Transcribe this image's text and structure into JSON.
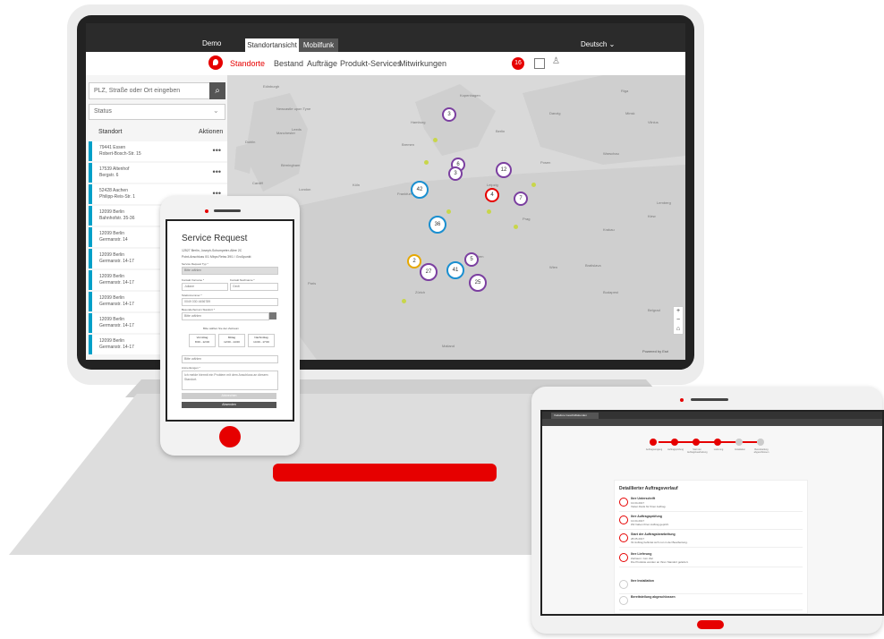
{
  "laptop_app": {
    "brand": "Demo",
    "tabs": [
      "Standortansicht",
      "Mobilfunk"
    ],
    "language": "Deutsch",
    "nav": [
      "Standorte",
      "Bestand",
      "Aufträge",
      "Produkt-Services",
      "Mitwirkungen"
    ],
    "notification_count": "16",
    "search_placeholder": "PLZ, Straße oder Ort eingeben",
    "status_label": "Status",
    "table_headers": [
      "Standort",
      "Aktionen"
    ],
    "rows": [
      {
        "line1": "79441 Essen",
        "line2": "Robert-Bosch-Str. 15"
      },
      {
        "line1": "17539 Altenhof",
        "line2": "Bergstr. 6"
      },
      {
        "line1": "52428 Aachen",
        "line2": "Philipp-Reis-Str. 1"
      },
      {
        "line1": "12099 Berlin",
        "line2": "Bahnhofstr. 35-36"
      },
      {
        "line1": "12099 Berlin",
        "line2": "Germanstr. 14"
      },
      {
        "line1": "12099 Berlin",
        "line2": "Germanstr. 14-17"
      },
      {
        "line1": "12099 Berlin",
        "line2": "Germanstr. 14-17"
      },
      {
        "line1": "12099 Berlin",
        "line2": "Germanstr. 14-17"
      },
      {
        "line1": "12099 Berlin",
        "line2": "Germanstr. 14-17"
      },
      {
        "line1": "12099 Berlin",
        "line2": "Germanstr. 14-17"
      }
    ],
    "map_clusters": [
      "3",
      "6",
      "12",
      "3",
      "4",
      "42",
      "7",
      "36",
      "2",
      "27",
      "41",
      "5",
      "25"
    ],
    "map_labels": [
      "Edinburgh",
      "Newcastle upon Tyne",
      "Dublin",
      "Manchester",
      "Leeds",
      "Birmingham",
      "London",
      "Cardiff",
      "Paris",
      "Hamburg",
      "Berlin",
      "Warschau",
      "Prag",
      "Wien",
      "Budapest",
      "Zürich",
      "Mailand",
      "Krakau",
      "Minsk",
      "Kiew",
      "Kopenhagen",
      "Riga",
      "Vilnius",
      "Danzig",
      "Posen",
      "Lemberg",
      "Bratislava",
      "Belgrad",
      "München",
      "Frankfurt",
      "Köln",
      "Bremen",
      "Leipzig"
    ],
    "map_attribution": "Powered by Esri",
    "accent": "#e60000"
  },
  "phone_app": {
    "title": "Service Request",
    "address": "12527 Berlin, Joseph-Schumpeter-Allee 2C",
    "ticket": "Point-Anschluss 0/1 Mbps Reiss 39/1 / Großpunkt",
    "fields": [
      {
        "label": "Service Request Typ *",
        "value": "Bitte wählen"
      },
      {
        "label": "Kontakt Vorname *",
        "value": "Juliane"
      },
      {
        "label": "Kontakt Nachname *",
        "value": "Gedt"
      },
      {
        "label": "Telefonnummer *",
        "value": "0049 030 4456789"
      },
      {
        "label": "Besonderheit am Standort *",
        "value": "Bitte wählen"
      }
    ],
    "hint": "Bitte wählen Sie den Zeitraum",
    "time_slots": [
      {
        "label": "Vormittag",
        "range": "8:00 - 12:00"
      },
      {
        "label": "Mittag",
        "range": "12:00 - 14:00"
      },
      {
        "label": "Nachmittag",
        "range": "14:00 - 17:00"
      }
    ],
    "dropdown": "Bitte wählen",
    "comment_label": "Anmerkungen *",
    "comment": "Ich melde hiermit ein Problem mit dem Anschluss an diesem Standort.",
    "cancel_label": "Abbrechen",
    "submit_label": "Absenden"
  },
  "tablet_app": {
    "browser_tab": "Vodafone Geschäftskunden",
    "steps": [
      "Auftragseingang",
      "Auftragsprüfung",
      "Start der Auftragsbearbeitung",
      "Lieferung",
      "Installation",
      "Bereitstellung abgeschlossen"
    ],
    "card_title": "Detaillierter Auftragsverlauf",
    "events": [
      {
        "title": "Ihre Unterschrift",
        "date": "13.04.2017",
        "text": "Vielen Dank für Ihren Auftrag."
      },
      {
        "title": "Ihre Auftragsprüfung",
        "date": "13.04.2017",
        "text": "Wir haben Ihren Auftrag geprüft."
      },
      {
        "title": "Start der Auftragsbearbeitung",
        "date": "28.05.2017",
        "text": "Ihr Auftrag befindet sich nun in der Bearbeitung."
      },
      {
        "title": "Ihre Lieferung",
        "date": "Zeitraum: zum Ziel",
        "text": "Die Produkte werden an Ihren Standort geliefert."
      },
      {
        "title": "Ihre Installation",
        "date": "",
        "text": ""
      },
      {
        "title": "Bereitstellung abgeschlossen",
        "date": "",
        "text": ""
      }
    ]
  }
}
